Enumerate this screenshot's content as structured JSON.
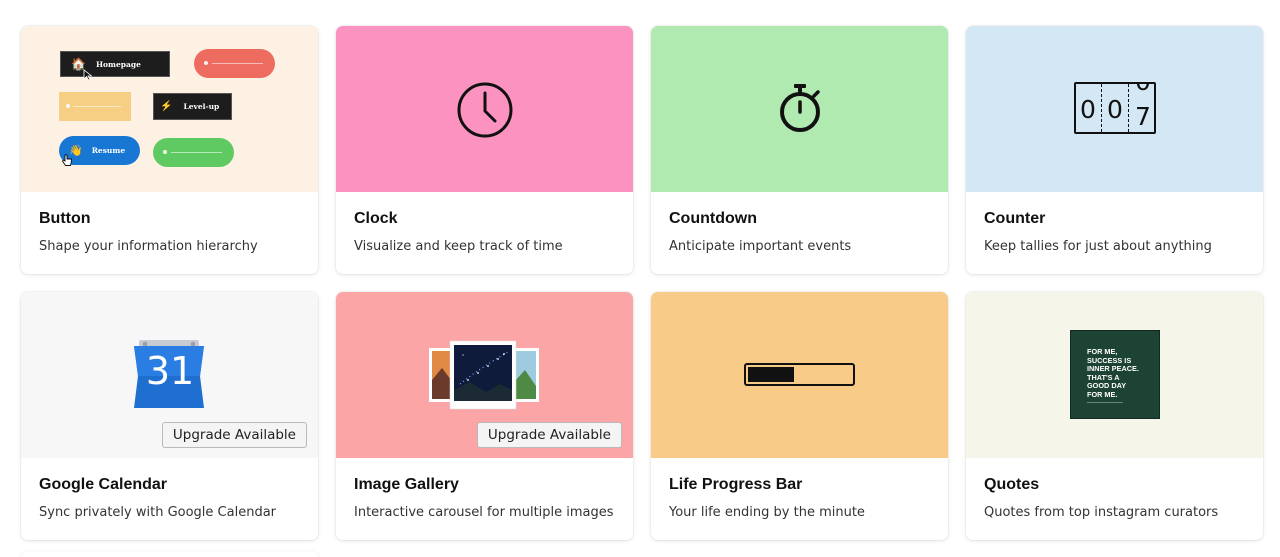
{
  "cards": [
    {
      "title": "Button",
      "description": "Shape your information hierarchy",
      "thumb_color": "#fdf1e3"
    },
    {
      "title": "Clock",
      "description": "Visualize and keep track of time",
      "thumb_color": "#fb92bf"
    },
    {
      "title": "Countdown",
      "description": "Anticipate important events",
      "thumb_color": "#b0eab0"
    },
    {
      "title": "Counter",
      "description": "Keep tallies for just about anything",
      "thumb_color": "#d3e8f4"
    },
    {
      "title": "Google Calendar",
      "description": "Sync privately with Google Calendar",
      "thumb_color": "#f7f7f7",
      "badge": "Upgrade Available"
    },
    {
      "title": "Image Gallery",
      "description": "Interactive carousel for multiple images",
      "thumb_color": "#fca5a6",
      "badge": "Upgrade Available"
    },
    {
      "title": "Life Progress Bar",
      "description": "Your life ending by the minute",
      "thumb_color": "#f8cc88"
    },
    {
      "title": "Quotes",
      "description": "Quotes from top instagram curators",
      "thumb_color": "#f5f5ea"
    }
  ],
  "button_preview": {
    "homepage_label": "Homepage",
    "levelup_label": "Level-up",
    "resume_label": "Resume",
    "colors": {
      "red": "#ee6b60",
      "yellow": "#f6cf85",
      "blue": "#1877d3",
      "green": "#5fc962",
      "dark": "#1d1d1d"
    }
  },
  "counter_preview": {
    "digits": [
      "0",
      "0",
      "7"
    ],
    "next_digit": "0"
  },
  "calendar_preview": {
    "day": "31",
    "color": "#1f6fd1"
  },
  "progress_preview": {
    "fill_fraction": 0.45
  },
  "quote_preview": {
    "text": "FOR ME,\nSUCCESS IS\nINNER PEACE.\nTHAT'S A\nGOOD DAY\nFOR ME."
  }
}
